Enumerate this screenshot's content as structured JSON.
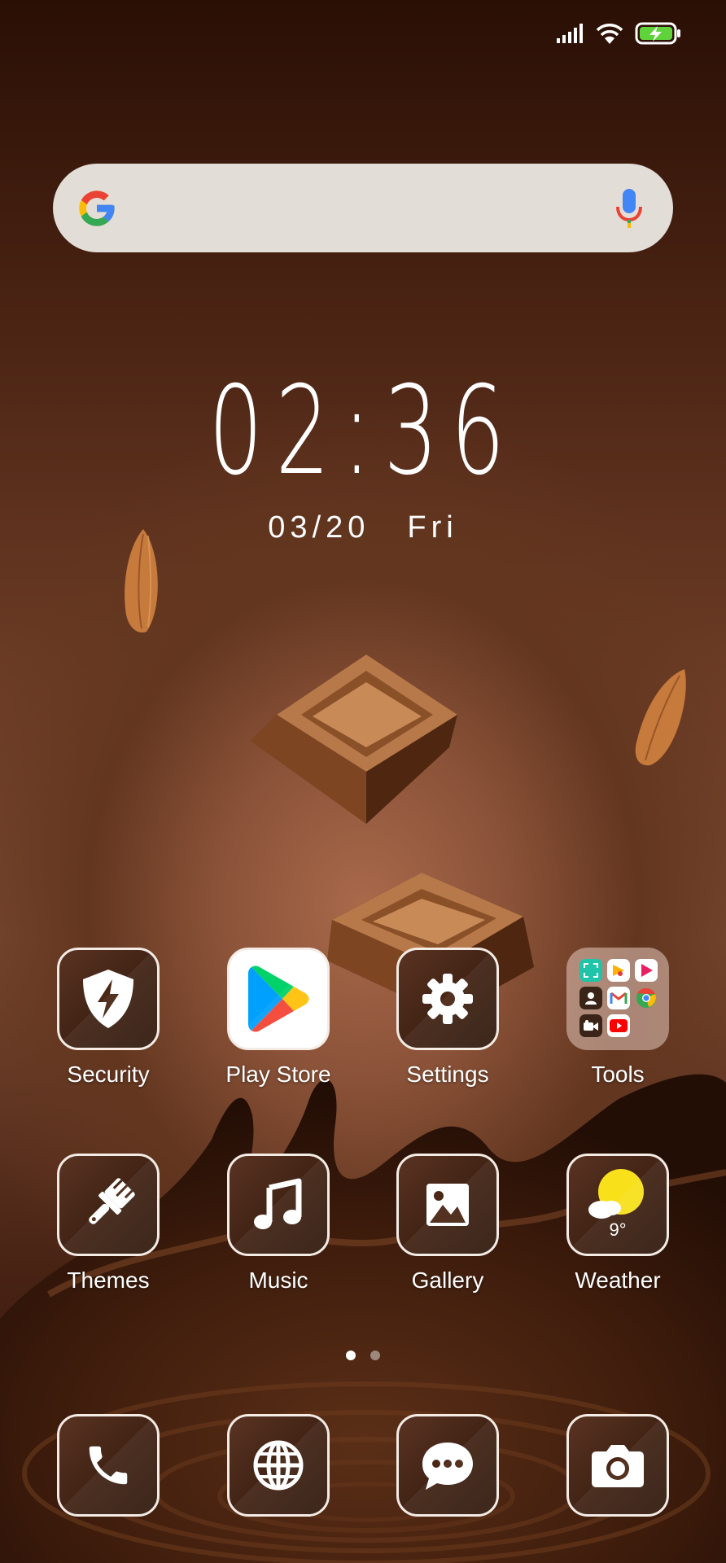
{
  "status_bar": {
    "icons": [
      "signal-icon",
      "wifi-icon",
      "battery-charging-icon"
    ],
    "battery_color": "#5fd33a"
  },
  "search": {
    "icons": [
      "google-logo-icon",
      "microphone-icon"
    ]
  },
  "clock": {
    "time": "02:36",
    "date": "03/20",
    "weekday": "Fri"
  },
  "apps_row1": [
    {
      "label": "Security",
      "icon": "shield-bolt-icon"
    },
    {
      "label": "Play Store",
      "icon": "play-store-icon"
    },
    {
      "label": "Settings",
      "icon": "gear-icon"
    },
    {
      "label": "Tools",
      "icon": "folder-icon"
    }
  ],
  "apps_row2": [
    {
      "label": "Themes",
      "icon": "brush-icon"
    },
    {
      "label": "Music",
      "icon": "music-note-icon"
    },
    {
      "label": "Gallery",
      "icon": "image-icon"
    },
    {
      "label": "Weather",
      "icon": "sun-cloud-icon",
      "temperature": "9°"
    }
  ],
  "dock": [
    {
      "icon": "phone-icon"
    },
    {
      "icon": "globe-icon"
    },
    {
      "icon": "message-icon"
    },
    {
      "icon": "camera-icon"
    }
  ],
  "pages": {
    "count": 2,
    "current": 1
  },
  "colors": {
    "accent": "#f3ebe4",
    "google_blue": "#4285F4",
    "google_red": "#EA4335",
    "google_yellow": "#FBBC05",
    "google_green": "#34A853",
    "weather_sun": "#f8e11a"
  }
}
